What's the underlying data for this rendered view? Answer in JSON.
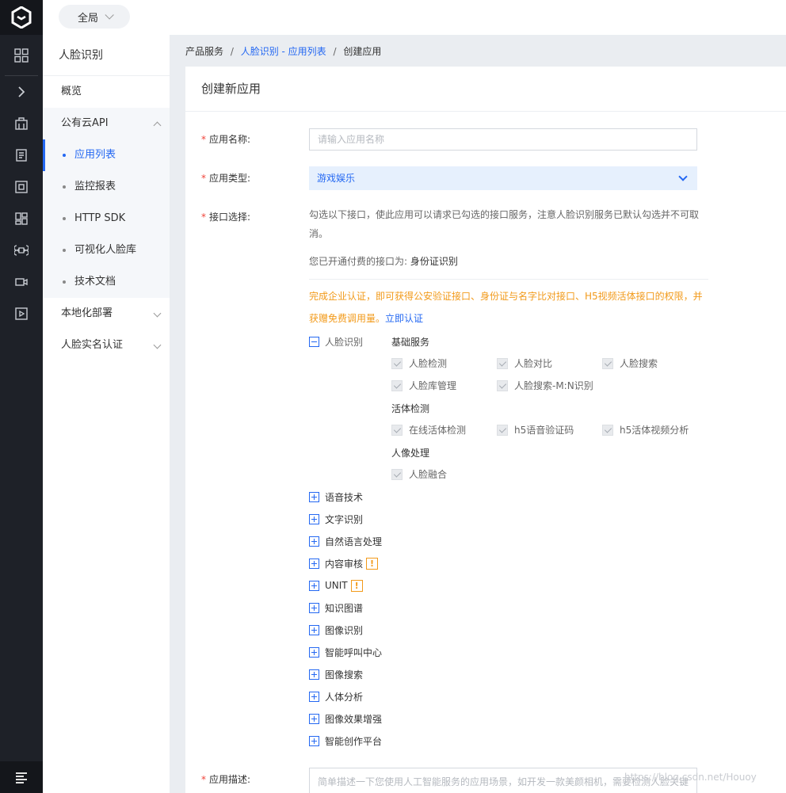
{
  "topbar": {
    "scope_label": "全局"
  },
  "sidebar": {
    "title": "人脸识别",
    "overview": "概览",
    "public_api": "公有云API",
    "sub_items": [
      "应用列表",
      "监控报表",
      "HTTP SDK",
      "可视化人脸库",
      "技术文档"
    ],
    "local_deploy": "本地化部署",
    "realname": "人脸实名认证"
  },
  "breadcrumb": {
    "root": "产品服务",
    "link": "人脸识别 - 应用列表",
    "current": "创建应用",
    "sep": "/"
  },
  "form": {
    "title": "创建新应用",
    "name_label": "应用名称:",
    "name_placeholder": "请输入应用名称",
    "type_label": "应用类型:",
    "type_value": "游戏娱乐",
    "api_label": "接口选择:",
    "api_help": "勾选以下接口，使此应用可以请求已勾选的接口服务，注意人脸识别服务已默认勾选并不可取消。",
    "opened_prefix": "您已开通付费的接口为:",
    "opened_value": "身份证识别",
    "warn_text": "完成企业认证，即可获得公安验证接口、身份证与名字比对接口、H5视频活体接口的权限，并获赠免费调用量。",
    "warn_link": "立即认证",
    "desc_label": "应用描述:",
    "desc_placeholder": "简单描述一下您使用人工智能服务的应用场景，如开发一款美颜相机，需要检测人脸关键点..."
  },
  "tree": {
    "face": "人脸识别",
    "groups": [
      {
        "title": "基础服务",
        "items": [
          "人脸检测",
          "人脸对比",
          "人脸搜索",
          "人脸库管理",
          "人脸搜索-M:N识别"
        ]
      },
      {
        "title": "活体检测",
        "items": [
          "在线活体检测",
          "h5语音验证码",
          "h5活体视频分析"
        ]
      },
      {
        "title": "人像处理",
        "items": [
          "人脸融合"
        ]
      }
    ],
    "collapsed": [
      "语音技术",
      "文字识别",
      "自然语言处理",
      "内容审核",
      "UNIT",
      "知识图谱",
      "图像识别",
      "智能呼叫中心",
      "图像搜索",
      "人体分析",
      "图像效果增强",
      "智能创作平台"
    ],
    "excl": "!"
  },
  "watermark": "https://blog.csdn.net/Houoy",
  "colors": {
    "accent": "#2468f2",
    "warning": "#f29a1a",
    "required": "#f0443a",
    "rail": "#1e2128"
  }
}
